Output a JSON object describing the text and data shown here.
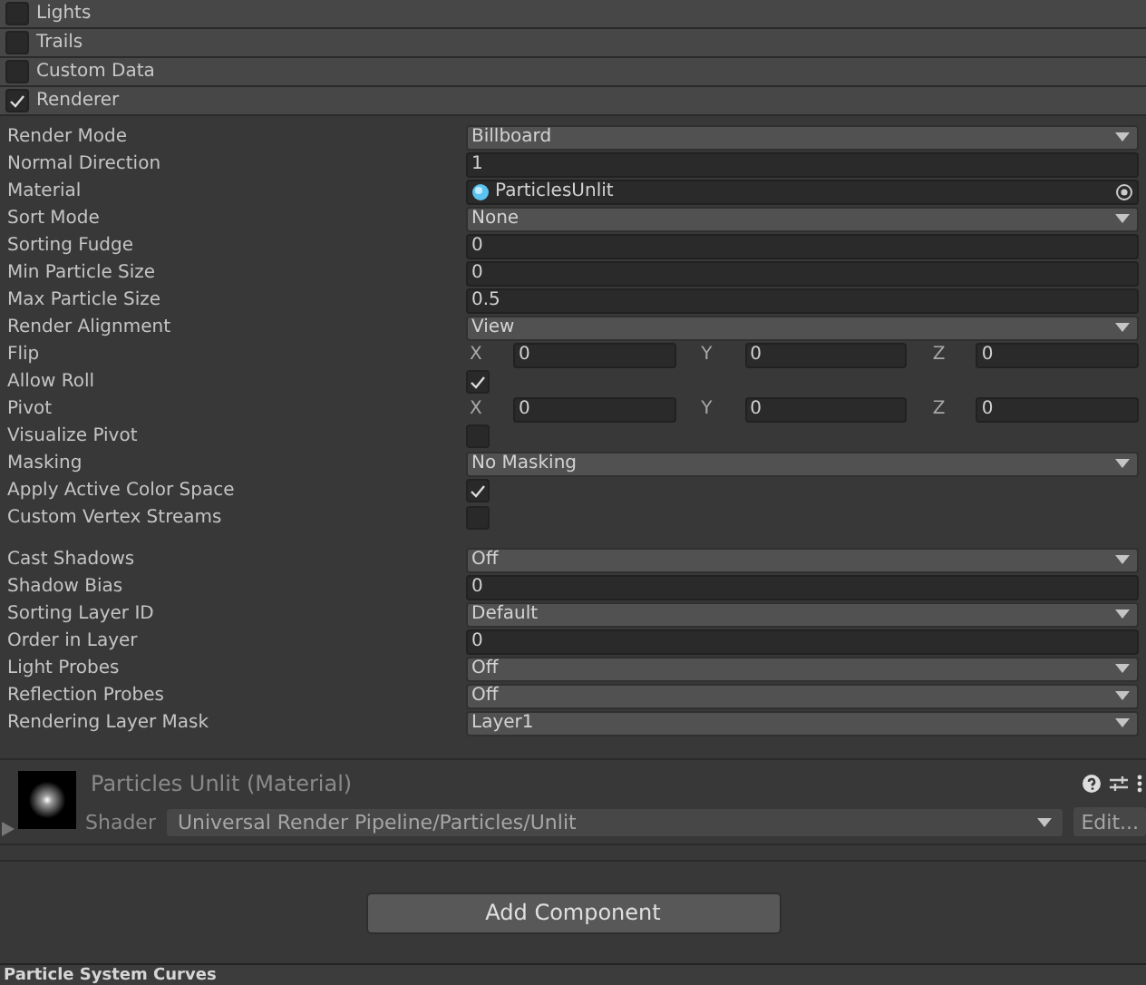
{
  "modules": [
    {
      "label": "Lights",
      "enabled": false
    },
    {
      "label": "Trails",
      "enabled": false
    },
    {
      "label": "Custom Data",
      "enabled": false
    },
    {
      "label": "Renderer",
      "enabled": true
    }
  ],
  "property_groups": [
    [
      {
        "label": "Render Mode",
        "kind": "dropdown",
        "value": "Billboard"
      },
      {
        "label": "Normal Direction",
        "kind": "field",
        "value": "1"
      },
      {
        "label": "Material",
        "kind": "object",
        "value": "ParticlesUnlit"
      },
      {
        "label": "Sort Mode",
        "kind": "dropdown",
        "value": "None"
      },
      {
        "label": "Sorting Fudge",
        "kind": "field",
        "value": "0"
      },
      {
        "label": "Min Particle Size",
        "kind": "field",
        "value": "0"
      },
      {
        "label": "Max Particle Size",
        "kind": "field",
        "value": "0.5"
      },
      {
        "label": "Render Alignment",
        "kind": "dropdown",
        "value": "View"
      },
      {
        "label": "Flip",
        "kind": "vector",
        "components": [
          {
            "axis": "X",
            "value": "0"
          },
          {
            "axis": "Y",
            "value": "0"
          },
          {
            "axis": "Z",
            "value": "0"
          }
        ]
      },
      {
        "label": "Allow Roll",
        "kind": "checkbox",
        "checked": true
      },
      {
        "label": "Pivot",
        "kind": "vector",
        "components": [
          {
            "axis": "X",
            "value": "0"
          },
          {
            "axis": "Y",
            "value": "0"
          },
          {
            "axis": "Z",
            "value": "0"
          }
        ]
      },
      {
        "label": "Visualize Pivot",
        "kind": "checkbox",
        "checked": false
      },
      {
        "label": "Masking",
        "kind": "dropdown",
        "value": "No Masking"
      },
      {
        "label": "Apply Active Color Space",
        "kind": "checkbox",
        "checked": true
      },
      {
        "label": "Custom Vertex Streams",
        "kind": "checkbox",
        "checked": false
      }
    ],
    [
      {
        "label": "Cast Shadows",
        "kind": "dropdown",
        "value": "Off"
      },
      {
        "label": "Shadow Bias",
        "kind": "field",
        "value": "0"
      },
      {
        "label": "Sorting Layer ID",
        "kind": "dropdown",
        "value": "Default"
      },
      {
        "label": "Order in Layer",
        "kind": "field",
        "value": "0"
      },
      {
        "label": "Light Probes",
        "kind": "dropdown",
        "value": "Off"
      },
      {
        "label": "Reflection Probes",
        "kind": "dropdown",
        "value": "Off"
      },
      {
        "label": "Rendering Layer Mask",
        "kind": "dropdown",
        "value": "Layer1"
      }
    ]
  ],
  "material": {
    "title": "Particles Unlit (Material)",
    "shader_label": "Shader",
    "shader": "Universal Render Pipeline/Particles/Unlit",
    "edit_button": "Edit..."
  },
  "add_component_button": "Add Component",
  "next_section": "Particle System Curves"
}
